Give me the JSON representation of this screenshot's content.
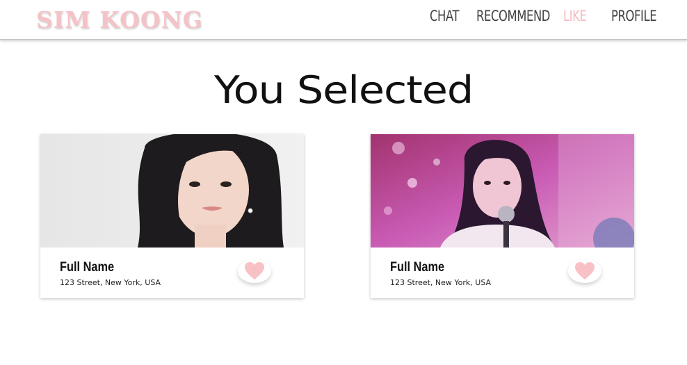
{
  "header": {
    "logo": "SIM KOONG",
    "nav": [
      {
        "label": "CHAT",
        "active": false
      },
      {
        "label": "RECOMMEND",
        "active": false
      },
      {
        "label": "LIKE",
        "active": true
      },
      {
        "label": "PROFILE",
        "active": false
      }
    ]
  },
  "main": {
    "title": "You Selected",
    "cards": [
      {
        "name": "Full Name",
        "address": "123 Street, New York, USA",
        "liked": true
      },
      {
        "name": "Full Name",
        "address": "123 Street, New York, USA",
        "liked": true
      }
    ]
  },
  "colors": {
    "accent_pink": "#f5b9c1",
    "heart": "#f7c1c6",
    "nav_text": "#444444"
  },
  "icons": [
    "heart-icon"
  ]
}
